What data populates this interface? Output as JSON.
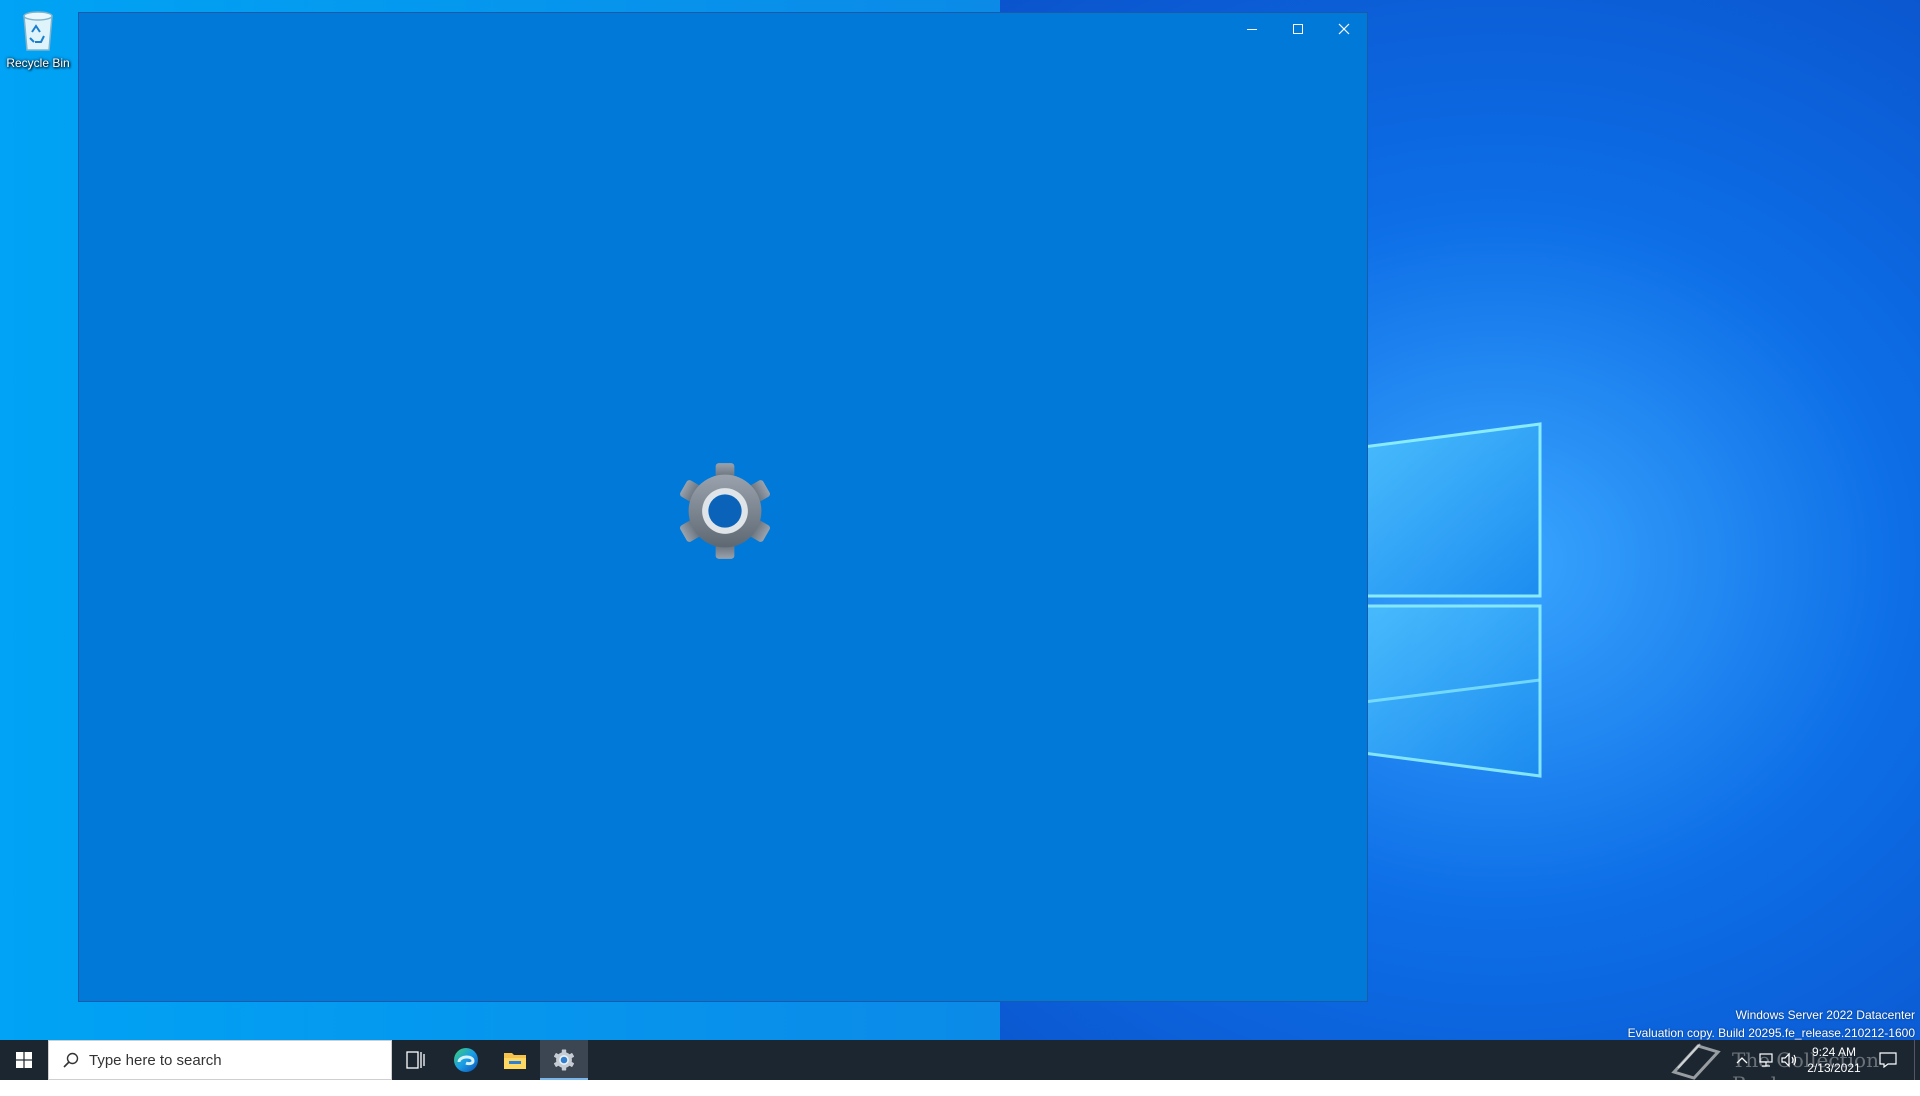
{
  "desktop": {
    "icons": [
      {
        "label": "Recycle Bin"
      }
    ],
    "watermark": {
      "line1": "Windows Server 2022 Datacenter",
      "line2": "Evaluation copy. Build 20295.fe_release.210212-1600"
    }
  },
  "window": {
    "app": "settings",
    "icon": "settings-gear-icon",
    "caption_buttons": [
      "minimize-icon",
      "maximize-icon",
      "close-icon"
    ],
    "background": "#0179d9"
  },
  "taskbar": {
    "search": {
      "placeholder": "Type here to search"
    },
    "pinned": [
      "task-view-icon",
      "edge-icon",
      "file-explorer-icon",
      "settings-gear-icon"
    ],
    "tray": {
      "overlay_text": "The Collection Book",
      "time": "9:24 AM",
      "date": "2/13/2021"
    }
  },
  "colors": {
    "taskbar": "#1c2630",
    "window_accent": "#0179d9",
    "active_indicator": "#7ab6ea"
  }
}
